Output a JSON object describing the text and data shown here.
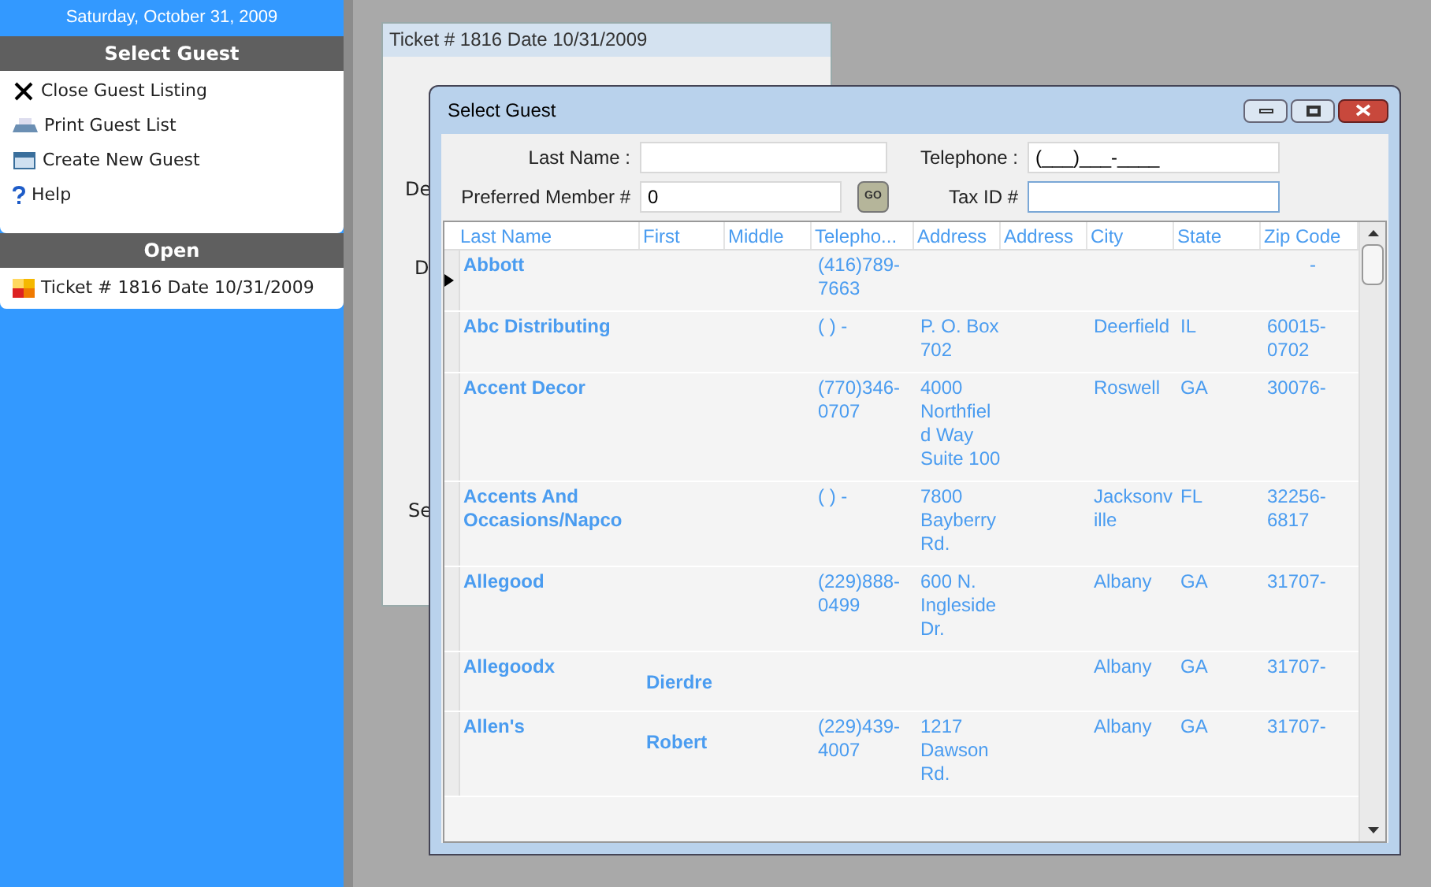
{
  "sidebar": {
    "date": "Saturday, October 31, 2009",
    "sections": [
      {
        "title": "Select Guest",
        "items": [
          {
            "kind": "close",
            "label": "Close Guest Listing"
          },
          {
            "kind": "print",
            "label": "Print Guest List"
          },
          {
            "kind": "new",
            "label": "Create New Guest"
          },
          {
            "kind": "help",
            "label": "Help"
          }
        ]
      },
      {
        "title": "Open",
        "items": [
          {
            "kind": "ticket",
            "label": "Ticket # 1816 Date 10/31/2009"
          }
        ]
      }
    ]
  },
  "background_window": {
    "title": "Ticket # 1816 Date 10/31/2009",
    "labels": [
      "De",
      "D",
      "Se"
    ]
  },
  "dialog": {
    "title": "Select Guest",
    "form": {
      "last_name": {
        "label": "Last Name :"
      },
      "telephone": {
        "label": "Telephone :",
        "value": "(___)___-____"
      },
      "preferred_member": {
        "label": "Preferred Member #",
        "value": "0",
        "button": "GO"
      },
      "tax_id": {
        "label": "Tax ID #"
      }
    },
    "table": {
      "columns": [
        "Last Name",
        "First",
        "Middle",
        "Telepho...",
        "Address",
        "Address",
        "City",
        "State",
        "Zip Code"
      ],
      "rows": [
        {
          "selected": true,
          "cells": [
            "Abbott",
            null,
            null,
            "(416)789-7663",
            null,
            null,
            null,
            null,
            "-"
          ]
        },
        {
          "selected": false,
          "cells": [
            "Abc Distributing",
            null,
            null,
            "(   )   -",
            "P. O. Box 702",
            null,
            "Deerfield",
            "IL",
            "60015-0702"
          ]
        },
        {
          "selected": false,
          "cells": [
            "Accent Decor",
            null,
            null,
            "(770)346-0707",
            "4000 Northfield Way Suite 100",
            null,
            "Roswell",
            "GA",
            "30076-"
          ]
        },
        {
          "selected": false,
          "cells": [
            "Accents And Occasions/Napco",
            null,
            null,
            "(   )   -",
            "7800 Bayberry Rd.",
            null,
            "Jacksonville",
            "FL",
            "32256-6817"
          ]
        },
        {
          "selected": false,
          "cells": [
            "Allegood",
            null,
            null,
            "(229)888-0499",
            "600 N. Ingleside Dr.",
            null,
            "Albany",
            "GA",
            "31707-"
          ]
        },
        {
          "selected": false,
          "cells": [
            "Allegoodx",
            "Dierdre",
            null,
            null,
            null,
            null,
            "Albany",
            "GA",
            "31707-"
          ]
        },
        {
          "selected": false,
          "cells": [
            "Allen's",
            "Robert",
            null,
            "(229)439-4007",
            "1217 Dawson Rd.",
            null,
            "Albany",
            "GA",
            "31707-"
          ]
        }
      ]
    }
  }
}
